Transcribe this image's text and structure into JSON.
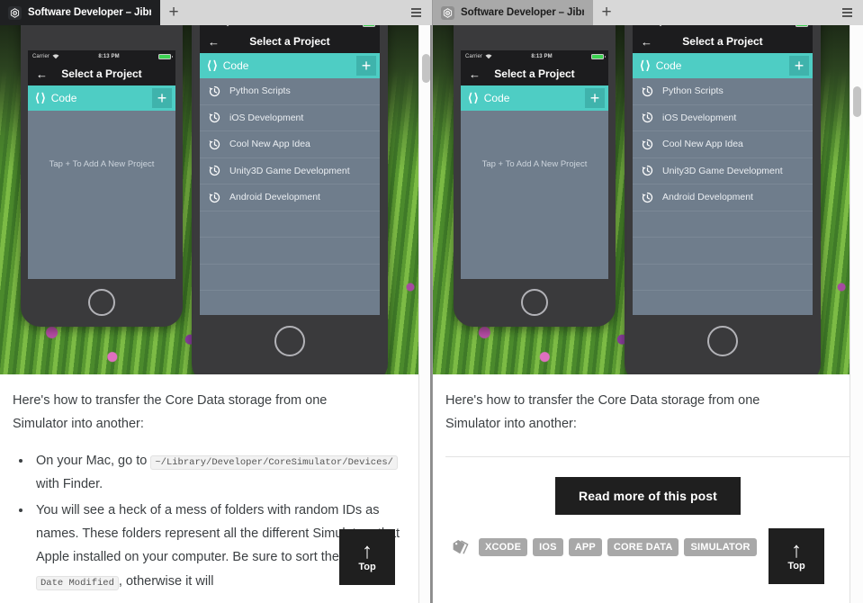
{
  "browser": {
    "tabs": [
      {
        "title": "Software Developer – Jibra",
        "favicon_icon": "app-logo-icon",
        "active": true
      },
      {
        "title": "Software Developer – Jibra",
        "favicon_icon": "app-logo-icon",
        "active": false
      }
    ],
    "new_tab_label": "+",
    "menu_icon": "hamburger-menu-icon"
  },
  "phone_mockup": {
    "status_bar": {
      "carrier": "Carrier",
      "wifi_icon": "wifi-icon",
      "time": "8:13 PM",
      "battery_icon": "battery-full-icon"
    },
    "nav": {
      "back_icon": "arrow-left-icon",
      "title": "Select a Project"
    },
    "project_header": {
      "chevrons_icon": "code-brackets-icon",
      "label": "Code",
      "add_label": "+",
      "add_icon": "plus-icon",
      "color": "#4ecdc4"
    },
    "empty_hint": "Tap  +  To Add A New Project",
    "projects": [
      {
        "icon": "history-clock-icon",
        "label": "Python Scripts"
      },
      {
        "icon": "history-clock-icon",
        "label": "iOS Development"
      },
      {
        "icon": "history-clock-icon",
        "label": "Cool New App Idea"
      },
      {
        "icon": "history-clock-icon",
        "label": "Unity3D Game Development"
      },
      {
        "icon": "history-clock-icon",
        "label": "Android Development"
      }
    ]
  },
  "article": {
    "lede": "Here's how to transfer the Core Data storage from one Simulator into another:",
    "bullets": [
      {
        "pre": "On your Mac, go to ",
        "code": "~/Library/Developer/CoreSimulator/Devices/",
        "post": " with Finder."
      },
      {
        "pre": "You will see a heck of a mess of folders with random IDs as names. These folders represent all the different Simulators that Apple installed on your computer. Be sure to sort the files by ",
        "code": "Date Modified",
        "post": ", otherwise it will"
      }
    ]
  },
  "post_footer": {
    "read_more_label": "Read more of this post",
    "tag_icon": "tag-icon",
    "tags": [
      "XCODE",
      "IOS",
      "APP",
      "CORE DATA",
      "SIMULATOR"
    ]
  },
  "top_button": {
    "arrow_icon": "arrow-up-icon",
    "label": "Top"
  },
  "colors": {
    "accent_teal": "#4ecdc4",
    "button_black": "#1f1f1f",
    "tag_gray": "#a8a8a8",
    "list_slate": "#6f7d8c",
    "text": "#3c4043"
  }
}
